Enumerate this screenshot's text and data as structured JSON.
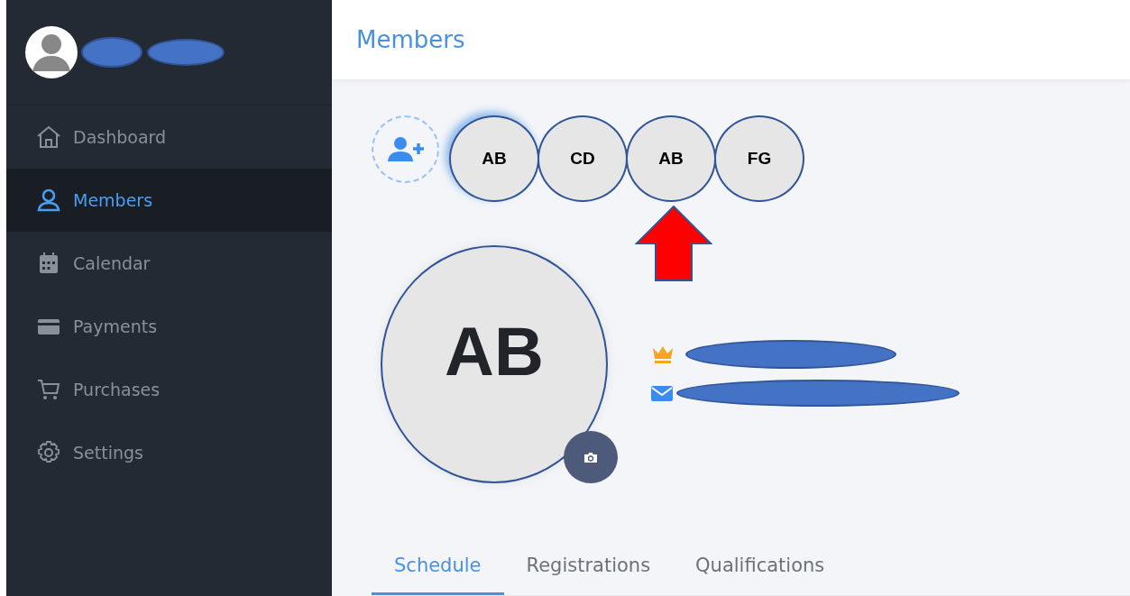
{
  "sidebar": {
    "items": [
      {
        "label": "Dashboard",
        "selected": false
      },
      {
        "label": "Members",
        "selected": true
      },
      {
        "label": "Calendar",
        "selected": false
      },
      {
        "label": "Payments",
        "selected": false
      },
      {
        "label": "Purchases",
        "selected": false
      },
      {
        "label": "Settings",
        "selected": false
      }
    ]
  },
  "header": {
    "title": "Members"
  },
  "members": [
    {
      "initials": "AB",
      "selected": true
    },
    {
      "initials": "CD",
      "selected": false
    },
    {
      "initials": "AB",
      "selected": false
    },
    {
      "initials": "FG",
      "selected": false
    }
  ],
  "profile": {
    "initials": "AB"
  },
  "tabs": [
    {
      "label": "Schedule",
      "selected": true
    },
    {
      "label": "Registrations",
      "selected": false
    },
    {
      "label": "Qualifications",
      "selected": false
    }
  ]
}
